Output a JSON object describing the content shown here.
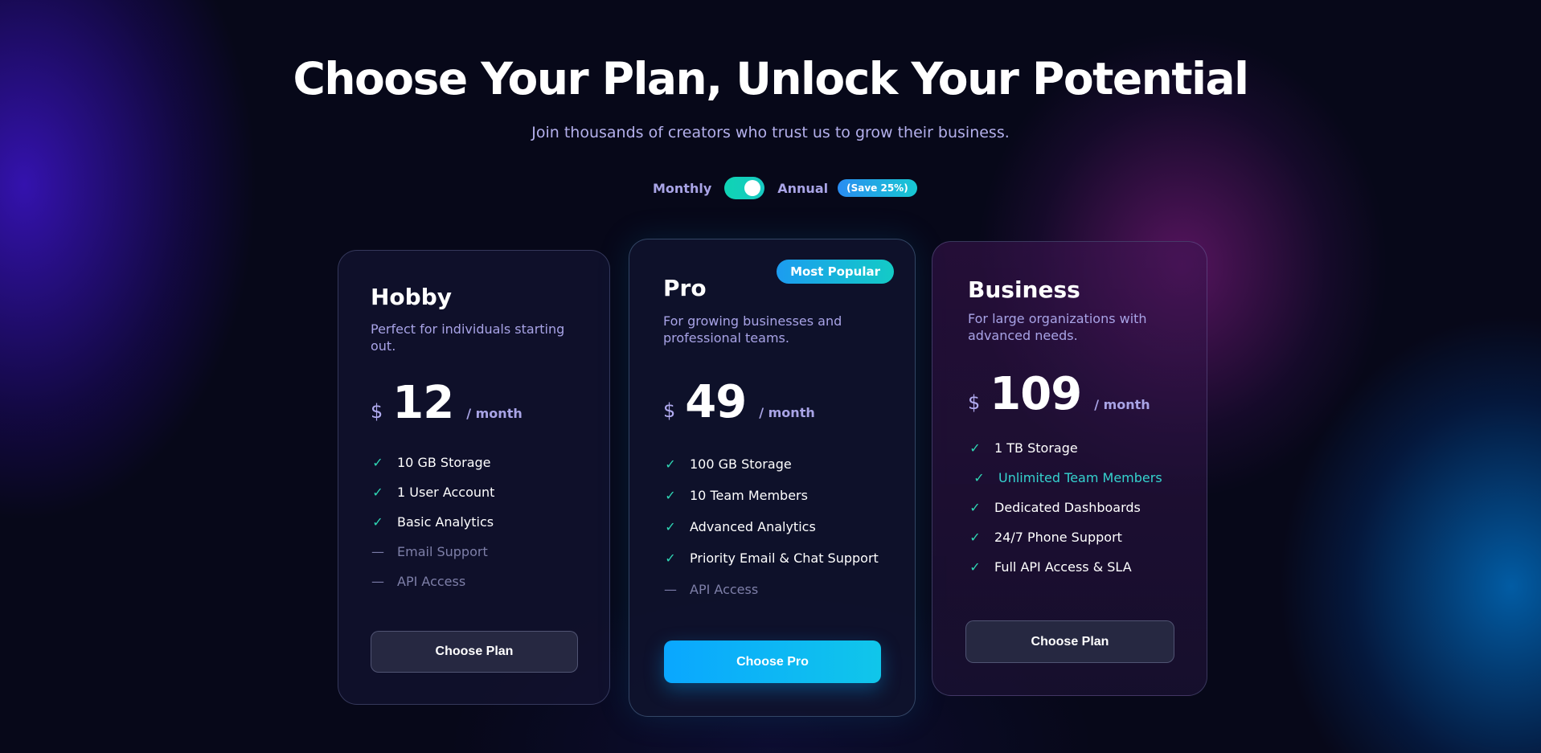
{
  "header": {
    "title": "Choose Your Plan, Unlock Your Potential",
    "subtitle": "Join thousands of creators who trust us to grow their business."
  },
  "billing_toggle": {
    "monthly_label": "Monthly",
    "annual_label": "Annual",
    "save_badge": "(Save 25%)",
    "selected": "Annual"
  },
  "plans": [
    {
      "name": "Hobby",
      "description": "Perfect for individuals starting out.",
      "currency": "$",
      "price": "12",
      "period": "/ month",
      "features": [
        {
          "label": "10 GB Storage",
          "included": true
        },
        {
          "label": "1 User Account",
          "included": true
        },
        {
          "label": "Basic Analytics",
          "included": true
        },
        {
          "label": "Email Support",
          "included": false
        },
        {
          "label": "API Access",
          "included": false
        }
      ],
      "button_label": "Choose Plan"
    },
    {
      "name": "Pro",
      "badge": "Most Popular",
      "description": "For growing businesses and professional teams.",
      "currency": "$",
      "price": "49",
      "period": "/ month",
      "features": [
        {
          "label": "100 GB Storage",
          "included": true
        },
        {
          "label": "10 Team Members",
          "included": true
        },
        {
          "label": "Advanced Analytics",
          "included": true
        },
        {
          "label": "Priority Email & Chat Support",
          "included": true
        },
        {
          "label": "API Access",
          "included": false
        }
      ],
      "button_label": "Choose Pro"
    },
    {
      "name": "Business",
      "description": "For large organizations with advanced needs.",
      "currency": "$",
      "price": "109",
      "period": "/ month",
      "features": [
        {
          "label": "1 TB Storage",
          "included": true
        },
        {
          "label": "Unlimited Team Members",
          "included": true,
          "highlighted": true
        },
        {
          "label": "Dedicated Dashboards",
          "included": true
        },
        {
          "label": "24/7 Phone Support",
          "included": true
        },
        {
          "label": "Full API Access & SLA",
          "included": true
        }
      ],
      "button_label": "Choose Plan"
    }
  ],
  "icons": {
    "included": "check-icon",
    "excluded": "dash-icon"
  },
  "colors": {
    "accent_teal": "#2fd6b4",
    "accent_blue": "#0aa7ff",
    "background": "#070819",
    "muted_text": "#a8a3e6"
  }
}
